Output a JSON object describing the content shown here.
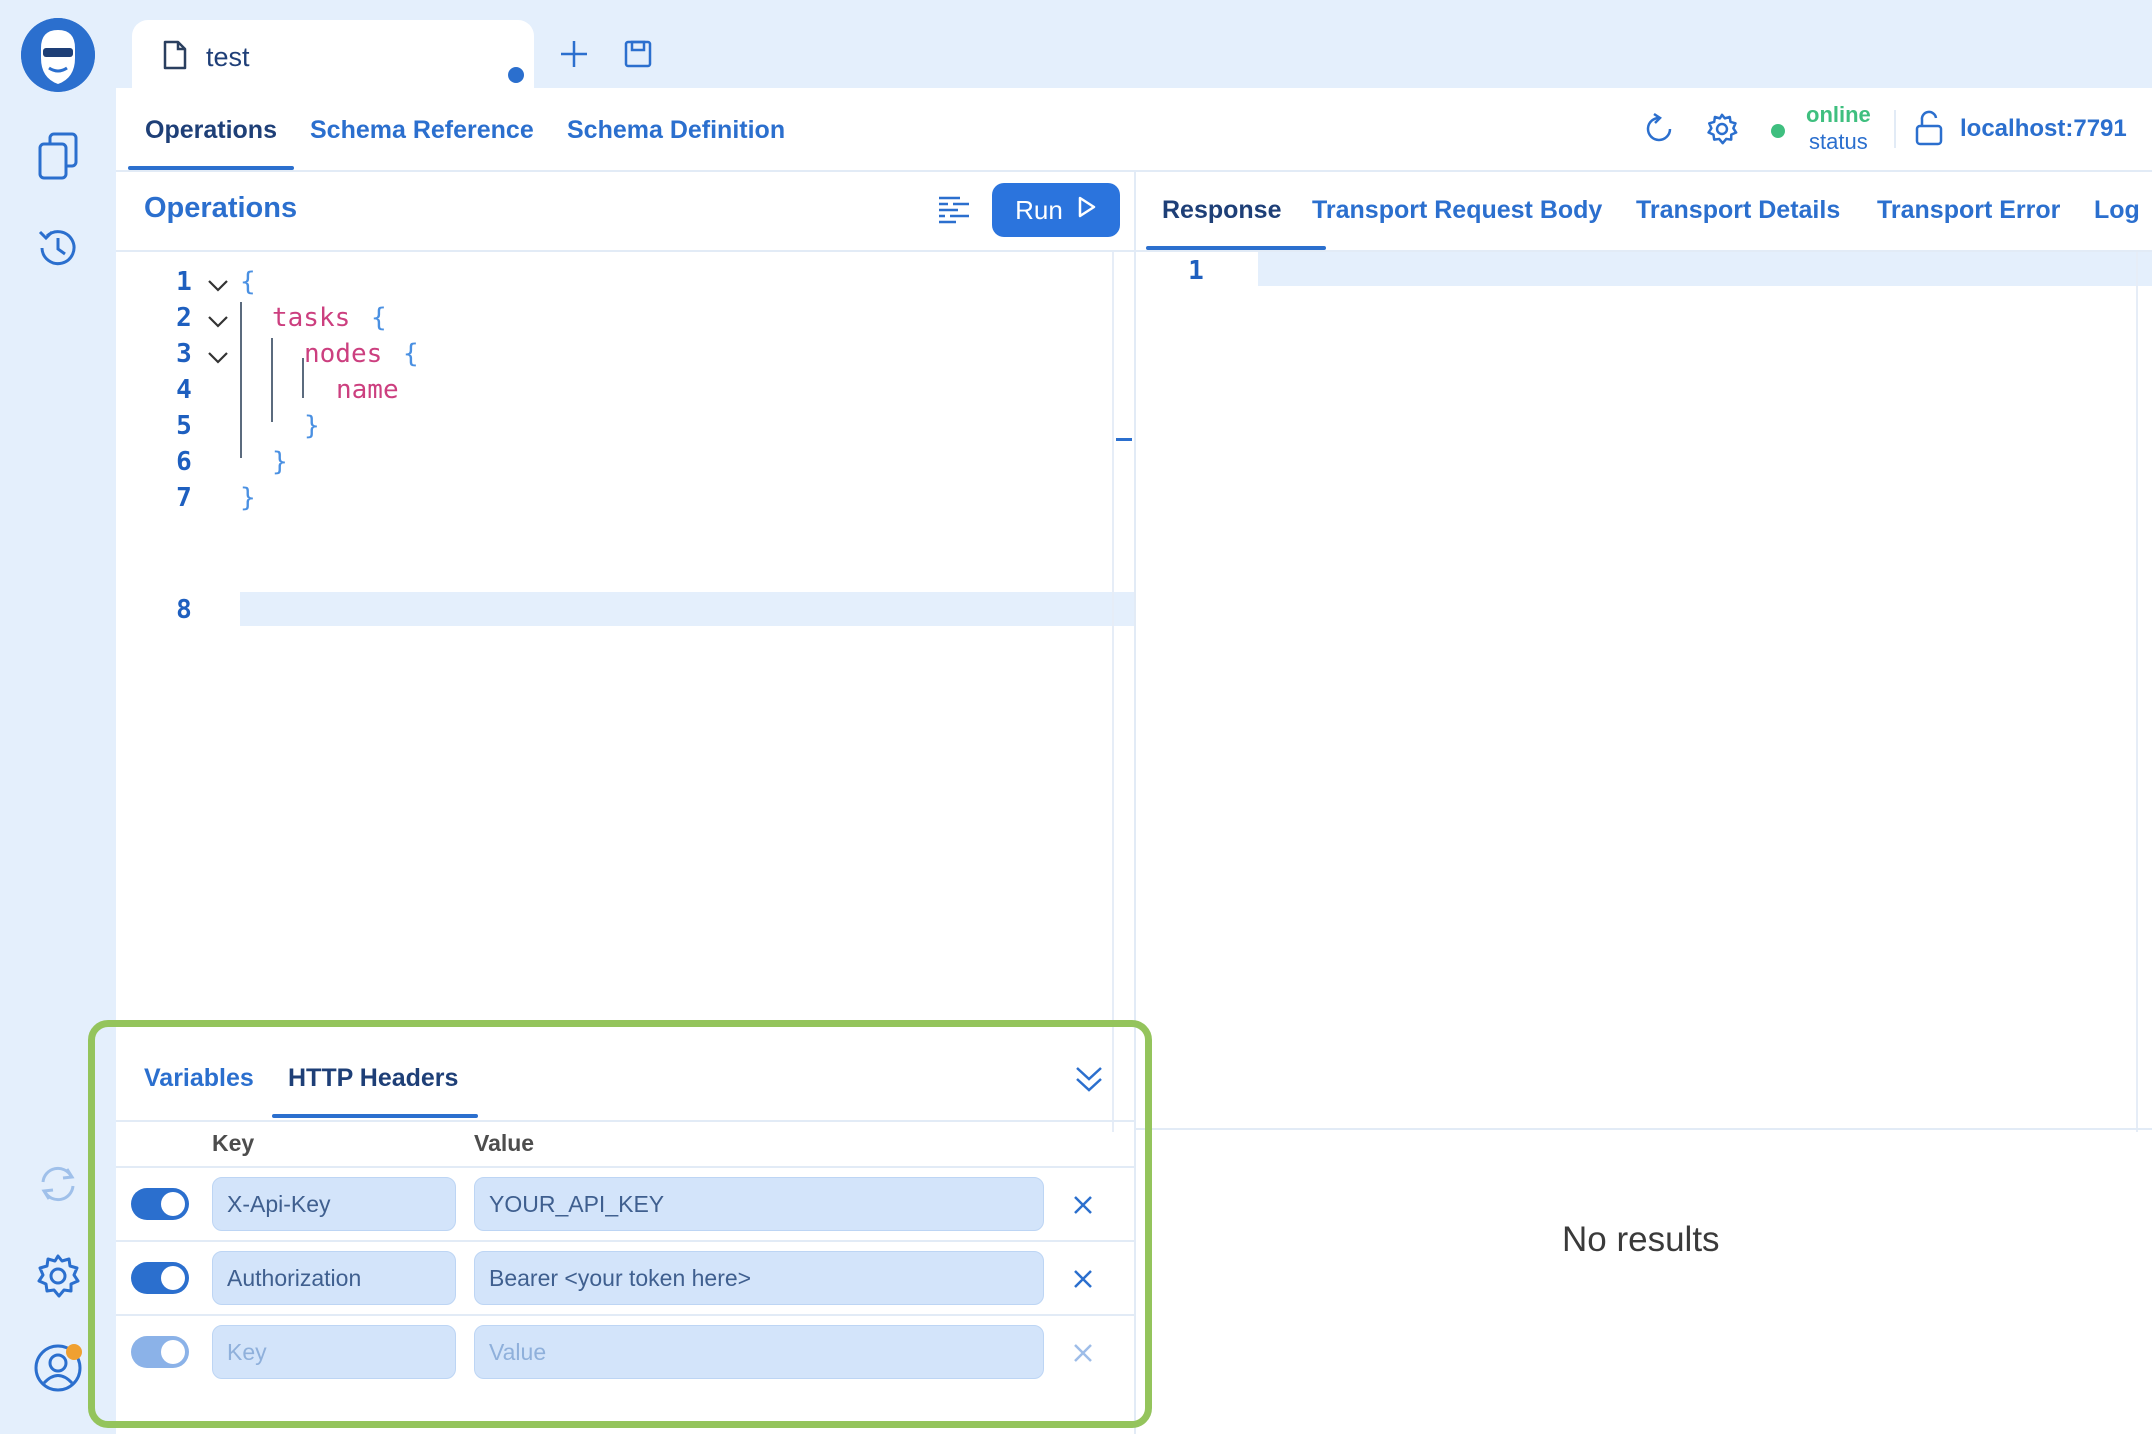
{
  "document_tab": {
    "title": "test"
  },
  "top_nav": {
    "tabs": [
      "Operations",
      "Schema Reference",
      "Schema Definition"
    ],
    "active": "Operations",
    "status": {
      "online": "online",
      "label": "status"
    },
    "endpoint": "localhost:7791"
  },
  "operations": {
    "title": "Operations",
    "run_label": "Run",
    "line_numbers": [
      "1",
      "2",
      "3",
      "4",
      "5",
      "6",
      "7",
      "8"
    ],
    "code": {
      "l1": "{",
      "l2_field": "tasks",
      "l2_brace": "{",
      "l3_field": "nodes",
      "l3_brace": "{",
      "l4_field": "name",
      "l5": "}",
      "l6": "}",
      "l7": "}"
    }
  },
  "response": {
    "tabs": [
      "Response",
      "Transport Request Body",
      "Transport Details",
      "Transport Error",
      "Log"
    ],
    "active": "Response",
    "line_number": "1",
    "empty_text": "No results"
  },
  "headers_panel": {
    "tabs": [
      "Variables",
      "HTTP Headers"
    ],
    "active": "HTTP Headers",
    "columns": {
      "key": "Key",
      "value": "Value"
    },
    "rows": [
      {
        "enabled": true,
        "key": "X-Api-Key",
        "value": "YOUR_API_KEY"
      },
      {
        "enabled": true,
        "key": "Authorization",
        "value": "Bearer <your token here>"
      }
    ],
    "new_row": {
      "key_placeholder": "Key",
      "value_placeholder": "Value"
    }
  },
  "colors": {
    "accent": "#2b6fce",
    "online": "#3fbf7f",
    "highlight_border": "#94c45c",
    "notification_dot": "#f0a030"
  }
}
